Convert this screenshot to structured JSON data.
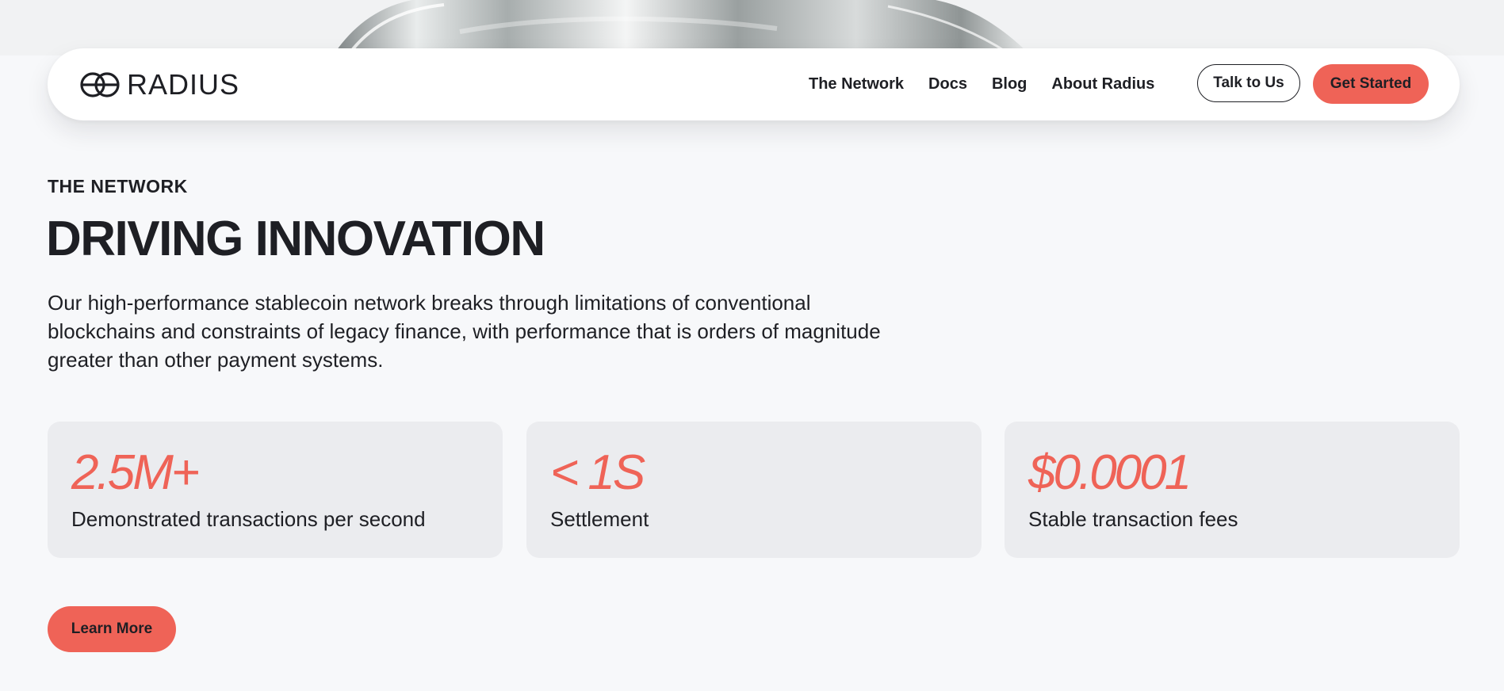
{
  "brand": {
    "name": "RADIUS",
    "logo_icon": "interlocking-rings-icon",
    "accent_color": "#ef6357",
    "text_color": "#1e1f24"
  },
  "nav": {
    "links": [
      "The Network",
      "Docs",
      "Blog",
      "About Radius"
    ],
    "talk_label": "Talk to Us",
    "start_label": "Get Started"
  },
  "section": {
    "eyebrow": "THE NETWORK",
    "headline": "DRIVING INNOVATION",
    "description": "Our high-performance stablecoin network breaks through limitations of conventional blockchains and constraints of legacy finance, with performance that is orders of magnitude greater than other payment systems."
  },
  "stats": [
    {
      "value": "2.5M+",
      "label": "Demonstrated transactions per second"
    },
    {
      "value": "< 1S",
      "label": "Settlement"
    },
    {
      "value": "$0.0001",
      "label": "Stable transaction fees"
    }
  ],
  "cta": {
    "learn_label": "Learn More"
  }
}
